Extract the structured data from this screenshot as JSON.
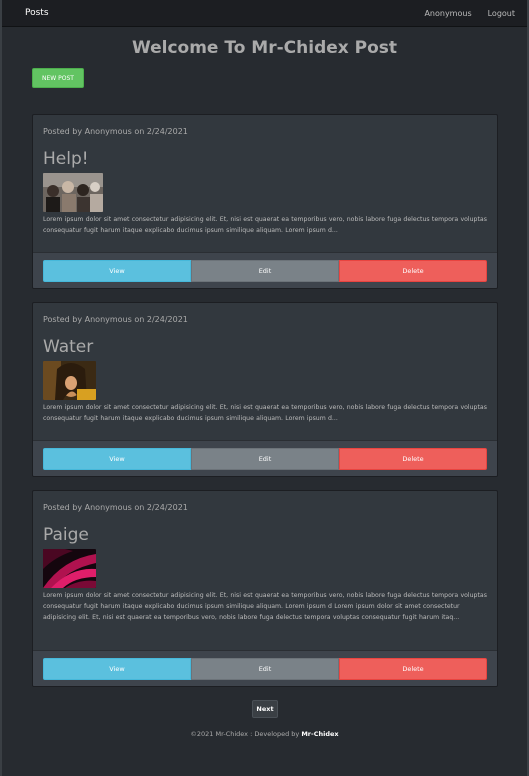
{
  "navbar": {
    "brand": "Posts",
    "user_link": "Anonymous",
    "logout_link": "Logout"
  },
  "page": {
    "title": "Welcome To Mr-Chidex Post",
    "new_post_label": "NEW POST"
  },
  "posts": [
    {
      "meta": "Posted by Anonymous on 2/24/2021",
      "title": "Help!",
      "image": "group-of-people-photo",
      "excerpt": "Lorem ipsum dolor sit amet consectetur adipisicing elit. Et, nisi est quaerat ea temporibus vero, nobis labore fuga delectus tempora voluptas consequatur fugit harum itaque explicabo ducimus ipsum similique aliquam. Lorem ipsum d...",
      "view_label": "View",
      "edit_label": "Edit",
      "delete_label": "Delete"
    },
    {
      "meta": "Posted by Anonymous on 2/24/2021",
      "title": "Water",
      "image": "woman-portrait-photo",
      "excerpt": "Lorem ipsum dolor sit amet consectetur adipisicing elit. Et, nisi est quaerat ea temporibus vero, nobis labore fuga delectus tempora voluptas consequatur fugit harum itaque explicabo ducimus ipsum similique aliquam. Lorem ipsum d...",
      "view_label": "View",
      "edit_label": "Edit",
      "delete_label": "Delete"
    },
    {
      "meta": "Posted by Anonymous on 2/24/2021",
      "title": "Paige",
      "image": "pink-abstract-photo",
      "excerpt": "Lorem ipsum dolor sit amet consectetur adipisicing elit. Et, nisi est quaerat ea temporibus vero, nobis labore fuga delectus tempora voluptas consequatur fugit harum itaque explicabo ducimus ipsum similique aliquam. Lorem ipsum d Lorem ipsum dolor sit amet consectetur adipisicing elit. Et, nisi est quaerat ea temporibus vero, nobis labore fuga delectus tempora voluptas consequatur fugit harum itaq...",
      "view_label": "View",
      "edit_label": "Edit",
      "delete_label": "Delete"
    }
  ],
  "pagination": {
    "next_label": "Next"
  },
  "footer": {
    "prefix": "©2021 Mr-Chidex : Developed by ",
    "author": "Mr-Chidex"
  },
  "colors": {
    "background": "#272b30",
    "card": "#32383e",
    "view": "#5bc0de",
    "edit": "#7a8288",
    "delete": "#ee5f5b",
    "new_post": "#62c462"
  }
}
